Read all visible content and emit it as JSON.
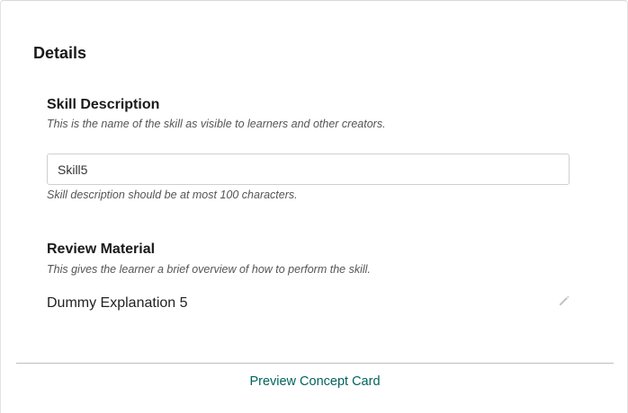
{
  "details": {
    "title": "Details"
  },
  "skill_description": {
    "title": "Skill Description",
    "hint": "This is the name of the skill as visible to learners and other creators.",
    "value": "Skill5",
    "limit_hint": "Skill description should be at most 100 characters."
  },
  "review_material": {
    "title": "Review Material",
    "hint": "This gives the learner a brief overview of how to perform the skill.",
    "content": "Dummy Explanation 5",
    "edit_icon": "pencil-icon"
  },
  "footer": {
    "preview_link": "Preview Concept Card",
    "link_color": "#00645c"
  }
}
